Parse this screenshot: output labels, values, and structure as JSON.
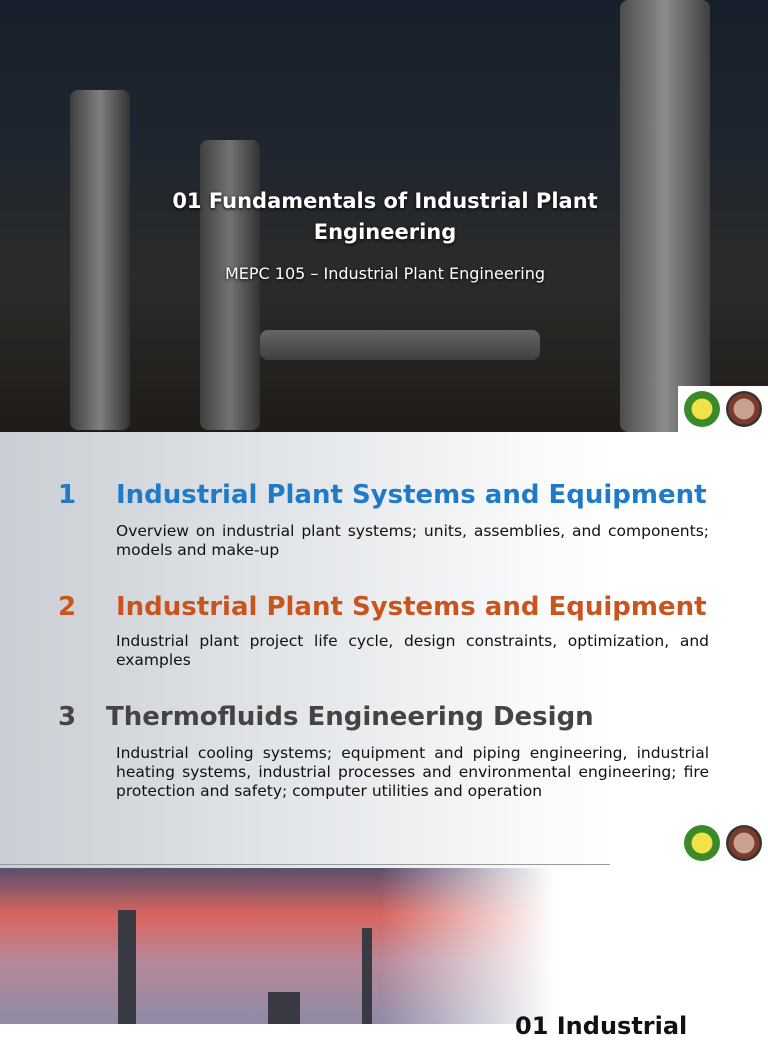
{
  "slide1": {
    "title": "01 Fundamentals of Industrial Plant Engineering",
    "subtitle": "MEPC 105 – Industrial Plant Engineering"
  },
  "slide2": {
    "items": [
      {
        "number": "1",
        "heading": "Industrial Plant Systems and Equipment",
        "description": "Overview on industrial plant systems; units, assemblies, and components; models and make-up",
        "color": "#1f7ac8"
      },
      {
        "number": "2",
        "heading": "Industrial Plant Systems and Equipment",
        "description": "Industrial plant project life cycle, design constraints, optimization, and examples",
        "color": "#c9541e"
      },
      {
        "number": "3",
        "heading": "Thermofluids Engineering Design",
        "description": "Industrial cooling systems; equipment and piping engineering, industrial heating systems, industrial processes and environmental engineering; fire protection and safety; computer utilities and operation",
        "color": "#444444"
      }
    ]
  },
  "slide3": {
    "title": "01 Industrial"
  }
}
